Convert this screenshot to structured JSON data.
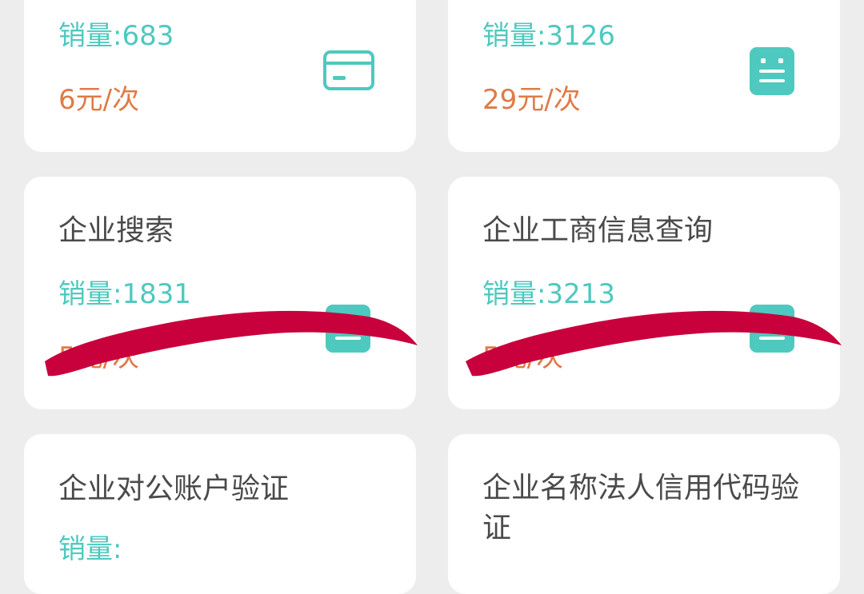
{
  "cards": [
    {
      "sales": "销量:683",
      "price": "6元/次",
      "icon": "bank-card-icon"
    },
    {
      "sales": "销量:3126",
      "price": "29元/次",
      "icon": "document-list-icon"
    },
    {
      "title": "企业搜索",
      "sales": "销量:1831",
      "price": "5元/次",
      "icon": "document-list-icon"
    },
    {
      "title": "企业工商信息查询",
      "sales": "销量:3213",
      "price": "5元/次",
      "icon": "document-list-icon"
    },
    {
      "title": "企业对公账户验证",
      "sales": "销量:"
    },
    {
      "title": "企业名称法人信用代码验证"
    }
  ],
  "colors": {
    "background": "#ededed",
    "card": "#ffffff",
    "title": "#4a4a4a",
    "sales": "#4ec9bf",
    "price": "#e07a46",
    "icon": "#4ec9bf",
    "scribble": "#c8003c"
  }
}
